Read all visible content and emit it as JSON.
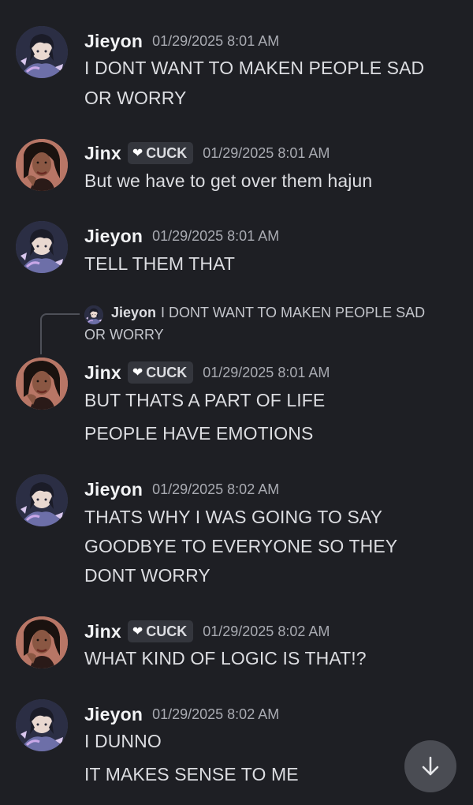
{
  "colors": {
    "background": "#1e1f24",
    "username": "#f2f3f5",
    "message_text": "#dcdde1",
    "timestamp": "#a9abb2",
    "tag_bg": "#34363d",
    "scroll_button_bg": "#4a4c53"
  },
  "messages": [
    {
      "author": "Jieyon",
      "timestamp": "01/29/2025 8:01 AM",
      "lines": [
        "I DONT WANT TO MAKEN PEOPLE SAD",
        "OR WORRY"
      ]
    },
    {
      "author": "Jinx",
      "tag": "CUCK",
      "tag_icon": "heart-icon",
      "timestamp": "01/29/2025 8:01 AM",
      "lines": [
        "But we have to get over them hajun"
      ]
    },
    {
      "author": "Jieyon",
      "timestamp": "01/29/2025 8:01 AM",
      "lines": [
        "TELL THEM THAT"
      ]
    },
    {
      "author": "Jinx",
      "tag": "CUCK",
      "tag_icon": "heart-icon",
      "timestamp": "01/29/2025 8:01 AM",
      "reply": {
        "author": "Jieyon",
        "text_line1": "I DONT WANT TO MAKEN PEOPLE SAD",
        "text_line2": "OR WORRY"
      },
      "lines": [
        "BUT THATS A PART OF LIFE",
        "PEOPLE HAVE EMOTIONS"
      ]
    },
    {
      "author": "Jieyon",
      "timestamp": "01/29/2025 8:02 AM",
      "lines": [
        "THATS WHY I WAS GOING TO SAY",
        "GOODBYE TO EVERYONE SO THEY",
        "DONT WORRY"
      ]
    },
    {
      "author": "Jinx",
      "tag": "CUCK",
      "tag_icon": "heart-icon",
      "timestamp": "01/29/2025 8:02 AM",
      "lines": [
        "WHAT KIND OF LOGIC IS THAT!?"
      ]
    },
    {
      "author": "Jieyon",
      "timestamp": "01/29/2025 8:02 AM",
      "lines": [
        "I DUNNO",
        "IT MAKES SENSE TO ME"
      ]
    }
  ],
  "scroll_button": {
    "icon": "arrow-down-icon"
  }
}
